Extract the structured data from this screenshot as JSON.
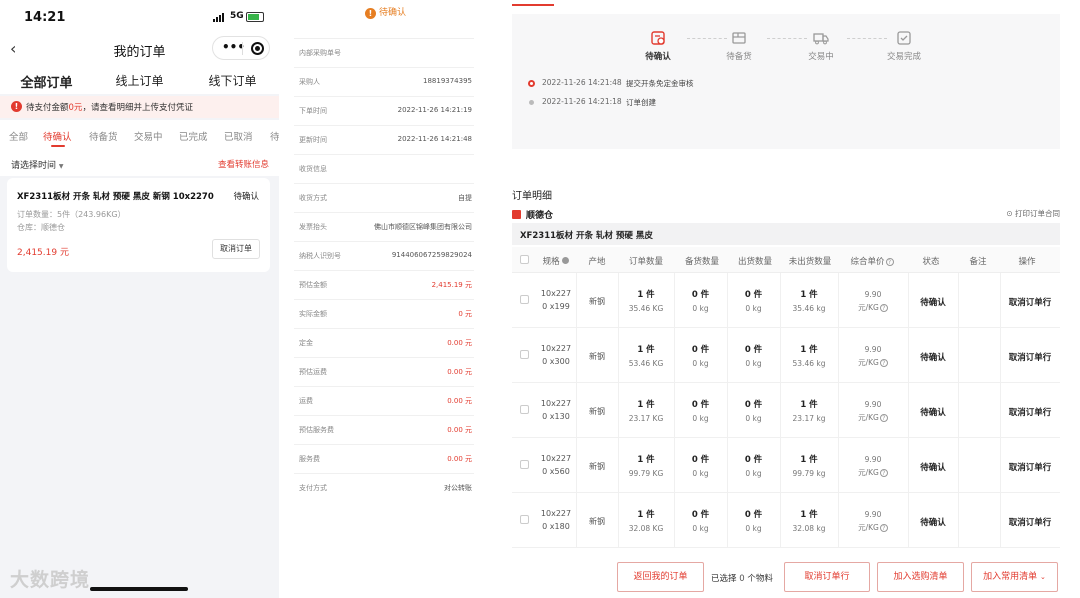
{
  "phone": {
    "status": {
      "time": "14:21",
      "network": "5G"
    },
    "nav": {
      "back": "‹",
      "title": "我的订单"
    },
    "tabs": [
      "全部订单",
      "线上订单",
      "线下订单"
    ],
    "alert": {
      "prefix": "待支付金额",
      "amount": "0元",
      "suffix": "，请查看明细并上传支付凭证"
    },
    "subtabs": [
      "全部",
      "待确认",
      "待备货",
      "交易中",
      "已完成",
      "已取消",
      "待"
    ],
    "filter": {
      "select_label": "请选择时间",
      "link": "查看转账信息"
    },
    "order": {
      "name": "XF2311板材 开条 轧材 预硬 黑皮 新钢 10x2270 ...",
      "state": "待确认",
      "qty": "订单数量：5件（243.96KG）",
      "warehouse": "仓库：顺德仓",
      "price": "2,415.19 元",
      "cancel": "取消订单"
    },
    "watermark": "大数跨境"
  },
  "detail": {
    "status": "待确认",
    "rows": [
      {
        "k": "内部采购单号",
        "v": "",
        "red": false
      },
      {
        "k": "采购人",
        "v": "18819374395",
        "red": false
      },
      {
        "k": "下单时间",
        "v": "2022-11-26 14:21:19",
        "red": false
      },
      {
        "k": "更新时间",
        "v": "2022-11-26 14:21:48",
        "red": false
      },
      {
        "k": "收货信息",
        "v": "",
        "red": false
      },
      {
        "k": "收货方式",
        "v": "自提",
        "red": false
      },
      {
        "k": "发票抬头",
        "v": "佛山市顺德区锦峰集团有限公司",
        "red": false
      },
      {
        "k": "纳税人识别号",
        "v": "914406067259829024",
        "red": false
      },
      {
        "k": "预估金额",
        "v": "2,415.19 元",
        "red": true
      },
      {
        "k": "实际金额",
        "v": "0 元",
        "red": true
      },
      {
        "k": "定金",
        "v": "0.00 元",
        "red": true
      },
      {
        "k": "预估运费",
        "v": "0.00 元",
        "red": true
      },
      {
        "k": "运费",
        "v": "0.00 元",
        "red": true
      },
      {
        "k": "预估服务费",
        "v": "0.00 元",
        "red": true
      },
      {
        "k": "服务费",
        "v": "0.00 元",
        "red": true
      },
      {
        "k": "支付方式",
        "v": "对公转账",
        "red": false
      }
    ]
  },
  "web": {
    "steps": [
      "待确认",
      "待备货",
      "交易中",
      "交易完成"
    ],
    "timeline": [
      {
        "time": "2022-11-26 14:21:48",
        "msg": "提交开条免定金审核"
      },
      {
        "time": "2022-11-26 14:21:18",
        "msg": "订单创建"
      }
    ],
    "section_title": "订单明细",
    "warehouse": "顺德仓",
    "print_link": "打印订单合同",
    "product": "XF2311板材 开条 轧材 预硬 黑皮",
    "headers": [
      "规格",
      "产地",
      "订单数量",
      "备货数量",
      "出货数量",
      "未出货数量",
      "综合单价",
      "状态",
      "备注",
      "操作"
    ],
    "rows": [
      {
        "spec1": "10x227",
        "spec2": "0 x199",
        "origin": "新钢",
        "ord": "1 件",
        "ordw": "35.46 KG",
        "stk": "0 件",
        "stkw": "0 kg",
        "out": "0 件",
        "outw": "0 kg",
        "un": "1 件",
        "unw": "35.46 kg",
        "price": "9.90",
        "unit": "元/KG",
        "status": "待确认",
        "op": "取消订单行"
      },
      {
        "spec1": "10x227",
        "spec2": "0 x300",
        "origin": "新钢",
        "ord": "1 件",
        "ordw": "53.46 KG",
        "stk": "0 件",
        "stkw": "0 kg",
        "out": "0 件",
        "outw": "0 kg",
        "un": "1 件",
        "unw": "53.46 kg",
        "price": "9.90",
        "unit": "元/KG",
        "status": "待确认",
        "op": "取消订单行"
      },
      {
        "spec1": "10x227",
        "spec2": "0 x130",
        "origin": "新钢",
        "ord": "1 件",
        "ordw": "23.17 KG",
        "stk": "0 件",
        "stkw": "0 kg",
        "out": "0 件",
        "outw": "0 kg",
        "un": "1 件",
        "unw": "23.17 kg",
        "price": "9.90",
        "unit": "元/KG",
        "status": "待确认",
        "op": "取消订单行"
      },
      {
        "spec1": "10x227",
        "spec2": "0 x560",
        "origin": "新钢",
        "ord": "1 件",
        "ordw": "99.79 KG",
        "stk": "0 件",
        "stkw": "0 kg",
        "out": "0 件",
        "outw": "0 kg",
        "un": "1 件",
        "unw": "99.79 kg",
        "price": "9.90",
        "unit": "元/KG",
        "status": "待确认",
        "op": "取消订单行"
      },
      {
        "spec1": "10x227",
        "spec2": "0 x180",
        "origin": "新钢",
        "ord": "1 件",
        "ordw": "32.08 KG",
        "stk": "0 件",
        "stkw": "0 kg",
        "out": "0 件",
        "outw": "0 kg",
        "un": "1 件",
        "unw": "32.08 kg",
        "price": "9.90",
        "unit": "元/KG",
        "status": "待确认",
        "op": "取消订单行"
      }
    ],
    "bottom": {
      "back": "返回我的订单",
      "sel_prefix": "已选择",
      "sel_count": "0",
      "sel_suffix": "个物料",
      "cancel_lines": "取消订单行",
      "add_purchase": "加入选购清单",
      "add_common": "加入常用清单"
    }
  },
  "colors": {
    "accent": "#e23b2f",
    "warning": "#e67e22"
  },
  "icons": [
    "signal-icon",
    "battery-icon",
    "back-icon",
    "more-icon",
    "target-icon",
    "alert-icon",
    "warning-icon",
    "step-confirm-icon",
    "step-stock-icon",
    "step-truck-icon",
    "step-done-icon",
    "warehouse-icon",
    "print-icon",
    "help-icon",
    "chevron-down-icon"
  ]
}
